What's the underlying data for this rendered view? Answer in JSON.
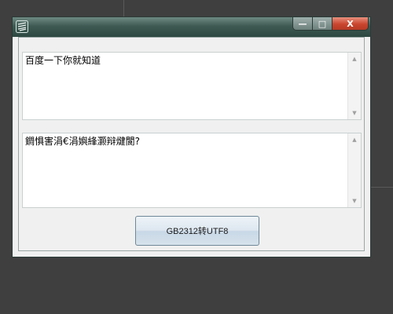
{
  "window": {
    "title": "",
    "controls": {
      "minimize": "—",
      "maximize": "□",
      "close": "X"
    }
  },
  "input_box": {
    "text": "百度一下你就知道"
  },
  "output_box": {
    "text": "鐧惧害涓€涓嬩綘灏辩煡閬?"
  },
  "convert_button": {
    "label": "GB2312转UTF8"
  },
  "colors": {
    "desktop": "#3f3f3f",
    "titlebar": "#3e5a53",
    "close": "#c9452e"
  },
  "icons": [
    "app-icon",
    "scroll-up-arrow",
    "scroll-down-arrow"
  ]
}
